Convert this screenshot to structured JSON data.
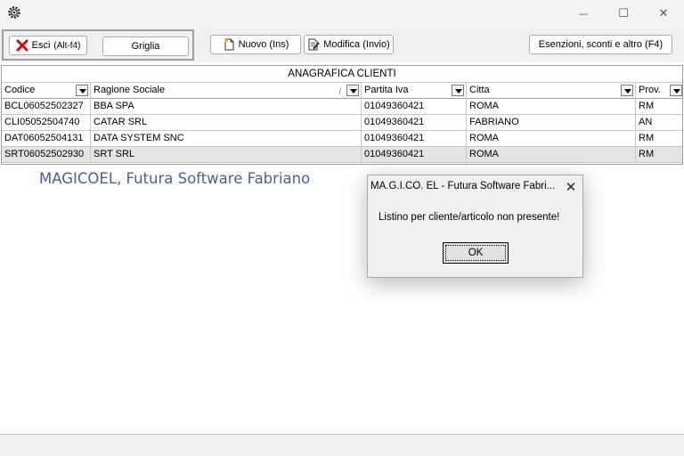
{
  "window": {
    "icons": {
      "app": "gear-app-icon",
      "minimize": "minimize-icon",
      "maximize": "maximize-icon",
      "close": "close-icon"
    },
    "minimize_glyph": "—",
    "maximize_glyph": "☐",
    "close_glyph": "✕"
  },
  "toolbar": {
    "exit_label": "Esci",
    "exit_shortcut": "(Alt-f4)",
    "grid_label": "Griglia",
    "new_label": "Nuovo (Ins)",
    "edit_label": "Modifica (Invio)",
    "exemptions_label": "Esenzioni, sconti e altro (F4)"
  },
  "grid": {
    "caption": "ANAGRAFICA CLIENTI",
    "sort_mark": "/",
    "columns": [
      "Codice",
      "Ragione Sociale",
      "Partita Iva",
      "Citta",
      "Prov."
    ],
    "rows": [
      [
        "BCL06052502327",
        "BBA SPA",
        "01049360421",
        "ROMA",
        "RM"
      ],
      [
        "CLI05052504740",
        "CATAR SRL",
        "01049360421",
        "FABRIANO",
        "AN"
      ],
      [
        "DAT06052504131",
        "DATA SYSTEM SNC",
        "01049360421",
        "ROMA",
        "RM"
      ],
      [
        "SRT06052502930",
        "SRT SRL",
        "01049360421",
        "ROMA",
        "RM"
      ]
    ],
    "selected_row": 3
  },
  "watermark": "MAGICOEL, Futura Software Fabriano",
  "dialog": {
    "title": "MA.G.I.CO. EL - Futura Software Fabri...",
    "close_glyph": "✕",
    "message": "Listino per cliente/articolo non presente!",
    "ok_label": "OK"
  },
  "colors": {
    "watermark": "#4e5e9c",
    "exit_icon": "#c81010",
    "selected_row": "#e4e4e4"
  }
}
